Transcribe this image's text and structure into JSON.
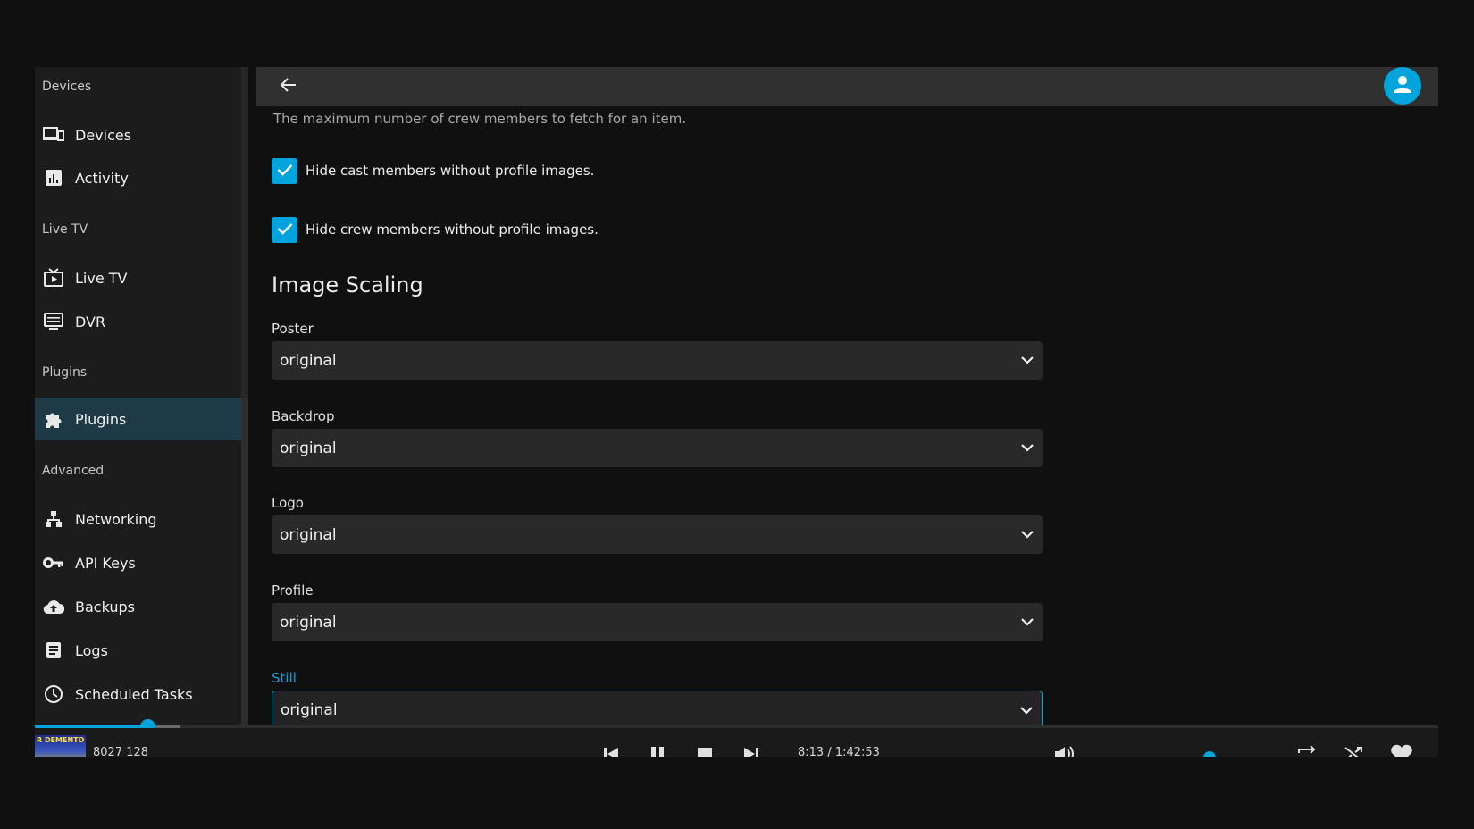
{
  "sidebar": {
    "sections": [
      {
        "header": "Devices",
        "items": [
          {
            "label": "Devices",
            "icon": "devices-icon"
          },
          {
            "label": "Activity",
            "icon": "activity-icon"
          }
        ]
      },
      {
        "header": "Live TV",
        "items": [
          {
            "label": "Live TV",
            "icon": "live-tv-icon"
          },
          {
            "label": "DVR",
            "icon": "dvr-icon"
          }
        ]
      },
      {
        "header": "Plugins",
        "items": [
          {
            "label": "Plugins",
            "icon": "puzzle-icon",
            "active": true
          }
        ]
      },
      {
        "header": "Advanced",
        "items": [
          {
            "label": "Networking",
            "icon": "network-icon"
          },
          {
            "label": "API Keys",
            "icon": "key-icon"
          },
          {
            "label": "Backups",
            "icon": "cloud-upload-icon"
          },
          {
            "label": "Logs",
            "icon": "logs-icon"
          },
          {
            "label": "Scheduled Tasks",
            "icon": "clock-icon"
          }
        ]
      }
    ]
  },
  "main": {
    "description": "The maximum number of crew members to fetch for an item.",
    "checkboxes": [
      {
        "label": "Hide cast members without profile images.",
        "checked": true
      },
      {
        "label": "Hide crew members without profile images.",
        "checked": true
      }
    ],
    "section_title": "Image Scaling",
    "fields": [
      {
        "label": "Poster",
        "value": "original"
      },
      {
        "label": "Backdrop",
        "value": "original"
      },
      {
        "label": "Logo",
        "value": "original"
      },
      {
        "label": "Profile",
        "value": "original"
      },
      {
        "label": "Still",
        "value": "original",
        "focused": true
      }
    ]
  },
  "player": {
    "title": "8027 128",
    "art_text": "R DEMENTD",
    "time": "8:13 / 1:42:53",
    "progress": 0.08,
    "buffered": 0.104,
    "volume": 1.0
  },
  "colors": {
    "accent": "#00a4dc",
    "background": "#101010",
    "sidebar": "#1c1c1c",
    "active_item": "#1e3a46"
  }
}
